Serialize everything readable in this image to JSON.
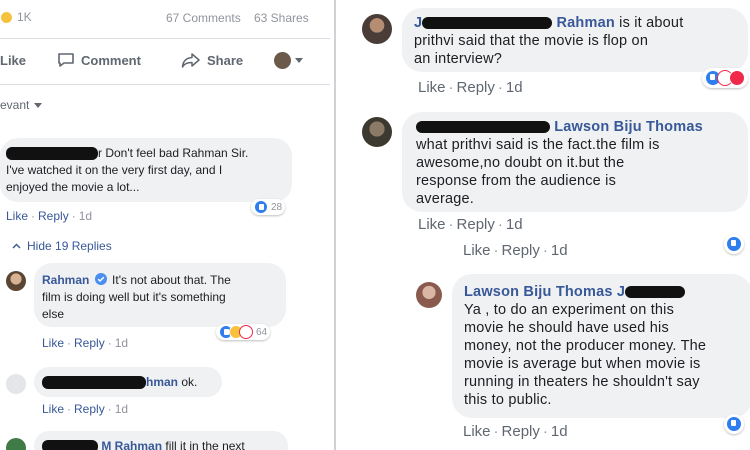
{
  "left": {
    "reaction_count": "1K",
    "comments_count": "67 Comments",
    "shares_count": "63 Shares",
    "like_label": "Like",
    "comment_label": "Comment",
    "share_label": "Share",
    "filter_label": "evant",
    "comments": [
      {
        "name": "",
        "text_lines": [
          "r Don't feel bad Rahman Sir.",
          "I've watched it on the very first day, and I",
          "enjoyed the movie a lot..."
        ],
        "like": "Like",
        "reply": "Reply",
        "time": "1d",
        "reactions": "28"
      },
      {
        "name": "Rahman",
        "text_lines": [
          "It's not about that. The",
          "film is doing well but it's something",
          "else"
        ],
        "like": "Like",
        "reply": "Reply",
        "time": "1d",
        "reactions": "64"
      },
      {
        "name": "hman",
        "text": "ok.",
        "like": "Like",
        "reply": "Reply",
        "time": "1d"
      },
      {
        "name": "M Rahman",
        "text": "fill it in the next"
      }
    ],
    "hide_replies": "Hide 19 Replies"
  },
  "right": {
    "comments": [
      {
        "name": "Rahman",
        "name_prefix": "J",
        "text_lines": [
          "is it about",
          "prithvi said that the movie is flop on",
          "an interview?"
        ],
        "like": "Like",
        "reply": "Reply",
        "time": "1d"
      },
      {
        "name": "Lawson Biju Thomas",
        "text_lines": [
          "what prithvi said is the fact.the film is",
          "awesome,no doubt on it.but the",
          "response from the audience is",
          "average."
        ],
        "like": "Like",
        "reply": "Reply",
        "time": "1d"
      },
      {
        "like": "Like",
        "reply": "Reply",
        "time": "1d"
      },
      {
        "name": "Lawson Biju Thomas J",
        "text_lines": [
          "Ya , to do an experiment on this",
          "movie he should have used his",
          "money, not the producer money. The",
          "movie is average but when movie is",
          "running in theaters he shouldn't say",
          "this to public."
        ],
        "like": "Like",
        "reply": "Reply",
        "time": "1d"
      }
    ]
  },
  "colors": {
    "link": "#385898",
    "bubble": "#eff1f3",
    "like_blue": "#2e7ef0",
    "love_red": "#f0284a",
    "haha_yellow": "#f7c23b"
  }
}
